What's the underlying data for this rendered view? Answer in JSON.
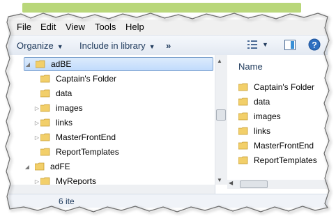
{
  "menubar": {
    "file": "File",
    "edit": "Edit",
    "view": "View",
    "tools": "Tools",
    "help": "Help"
  },
  "toolbar": {
    "organize": "Organize",
    "include": "Include in library",
    "more": "»"
  },
  "nav": {
    "items": [
      {
        "label": "adBE",
        "expanded": true,
        "selected": true
      },
      {
        "label": "Captain's Folder"
      },
      {
        "label": "data"
      },
      {
        "label": "images"
      },
      {
        "label": "links"
      },
      {
        "label": "MasterFrontEnd"
      },
      {
        "label": "ReportTemplates"
      },
      {
        "label": "adFE",
        "expanded": true
      },
      {
        "label": "MyReports"
      }
    ]
  },
  "content": {
    "column_header": "Name",
    "items": [
      {
        "label": "Captain's Folder"
      },
      {
        "label": "data"
      },
      {
        "label": "images"
      },
      {
        "label": "links"
      },
      {
        "label": "MasterFrontEnd"
      },
      {
        "label": "ReportTemplates"
      }
    ]
  },
  "status": {
    "text": "6 ite"
  },
  "colors": {
    "folder": "#f2cf6a",
    "accent": "#1e395b",
    "selection": "#c1dbfc"
  }
}
